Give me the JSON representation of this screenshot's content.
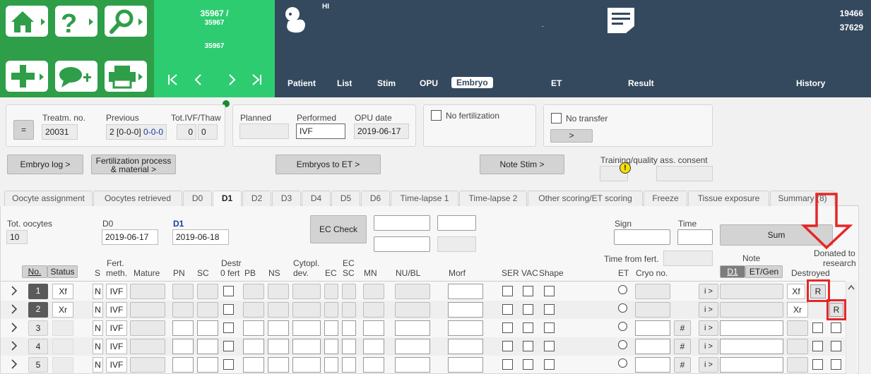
{
  "header": {
    "counter_top": "35967 /",
    "counter_mid": "35967",
    "counter_bottom": "35967",
    "patient_label": "HI",
    "dot": ".",
    "right_id_1": "19466",
    "right_id_2": "37629",
    "nav_first": "K",
    "nav_prev": "‹",
    "nav_next": "›",
    "nav_last": "›I"
  },
  "nav_tabs": [
    "Patient",
    "List",
    "Stim",
    "OPU",
    "Embryo",
    "ET",
    "Result",
    "History"
  ],
  "treatment": {
    "eq_button": "=",
    "treatm_no_label": "Treatm. no.",
    "treatm_no": "20031",
    "previous_label": "Previous",
    "previous_value": "2 [0-0-0]",
    "previous_blue": "0-0-0",
    "tot_label": "Tot.IVF/Thaw",
    "tot_ivf": "0",
    "tot_thaw": "0"
  },
  "procedure": {
    "planned_label": "Planned",
    "planned_value": "",
    "performed_label": "Performed",
    "performed_value": "IVF",
    "opu_label": "OPU date",
    "opu_value": "2019-06-17"
  },
  "no_fertilization": "No fertilization",
  "no_transfer": "No transfer",
  "no_transfer_button": ">",
  "buttons": {
    "embryo_log": "Embryo log >",
    "fert_line1": "Fertilization process",
    "fert_line2": "& material >",
    "embryos_to_et": "Embryos to ET >",
    "note_stim": "Note Stim >"
  },
  "consent_label": "Training/quality ass. consent",
  "sub_tabs": [
    "Oocyte assignment",
    "Oocytes retrieved",
    "D0",
    "D1",
    "D2",
    "D3",
    "D4",
    "D5",
    "D6",
    "Time-lapse 1",
    "Time-lapse 2",
    "Other scoring/ET scoring",
    "Freeze",
    "Tissue exposure",
    "Summary (8)"
  ],
  "d1": {
    "tot_oocytes_label": "Tot. oocytes",
    "tot_oocytes": "10",
    "d0_label": "D0",
    "d0_date": "2019-06-17",
    "d1_label": "D1",
    "d1_date": "2019-06-18",
    "ec_check": "EC Check",
    "sign_label": "Sign",
    "time_label": "Time",
    "sum_button": "Sum",
    "time_from_fert": "Time from fert.",
    "note_label": "Note",
    "note_tab_d1": "D1",
    "note_tab_et": "ET/Gen",
    "donated_line1": "Donated to",
    "donated_line2": "research",
    "destroyed_label": "Destroyed"
  },
  "columns": {
    "no": "No.",
    "status": "Status",
    "s": "S",
    "fert1": "Fert.",
    "fert2": "meth.",
    "mature": "Mature",
    "pn": "PN",
    "sc": "SC",
    "destr1": "Destr",
    "destr2": "0 fert",
    "pb": "PB",
    "ns": "NS",
    "cyto1": "Cytopl.",
    "cyto2": "dev.",
    "ec": "EC",
    "ecsc1": "EC",
    "ecsc2": "SC",
    "mn": "MN",
    "nubl": "NU/BL",
    "morf": "Morf",
    "ser": "SER",
    "vac": "VAC",
    "shape": "Shape",
    "et": "ET",
    "cryo": "Cryo no."
  },
  "rows": [
    {
      "no": "1",
      "status": "Xf",
      "s": "N",
      "fert": "IVF",
      "note_btn": "i >",
      "destroyed": "Xf",
      "research": "R"
    },
    {
      "no": "2",
      "status": "Xr",
      "s": "N",
      "fert": "IVF",
      "note_btn": "i >",
      "destroyed": "Xr",
      "research": "R"
    },
    {
      "no": "3",
      "status": "",
      "s": "N",
      "fert": "IVF",
      "note_btn": "i >",
      "hash": "#"
    },
    {
      "no": "4",
      "status": "",
      "s": "N",
      "fert": "IVF",
      "note_btn": "i >",
      "hash": "#"
    },
    {
      "no": "5",
      "status": "",
      "s": "N",
      "fert": "IVF",
      "note_btn": "i >",
      "hash": "#"
    }
  ],
  "colors": {
    "accent_green": "#2ecc71",
    "dark_header": "#34495e",
    "annotation_red": "#e52628"
  }
}
